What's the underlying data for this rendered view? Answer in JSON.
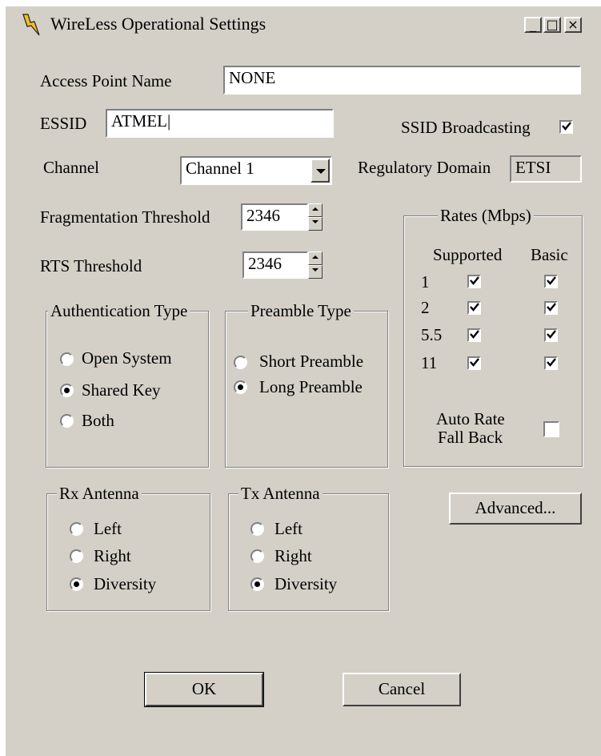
{
  "window": {
    "title": "WireLess Operational Settings"
  },
  "titlebar_buttons": {
    "minimize": "_",
    "maximize": "□",
    "close": "×"
  },
  "fields": {
    "access_point_name": {
      "label": "Access Point Name",
      "value": "NONE"
    },
    "essid": {
      "label": "ESSID",
      "value": "ATMEL"
    },
    "ssid_broadcasting": {
      "label": "SSID Broadcasting",
      "checked": true
    },
    "channel": {
      "label": "Channel",
      "value": "Channel 1"
    },
    "regulatory_domain": {
      "label": "Regulatory Domain",
      "value": "ETSI"
    },
    "fragmentation_threshold": {
      "label": "Fragmentation Threshold",
      "value": "2346"
    },
    "rts_threshold": {
      "label": "RTS Threshold",
      "value": "2346"
    }
  },
  "rates": {
    "title": "Rates (Mbps)",
    "col_supported": "Supported",
    "col_basic": "Basic",
    "rows": [
      {
        "rate": "1",
        "supported": true,
        "basic": true
      },
      {
        "rate": "2",
        "supported": true,
        "basic": true
      },
      {
        "rate": "5.5",
        "supported": true,
        "basic": true
      },
      {
        "rate": "11",
        "supported": true,
        "basic": true
      }
    ],
    "auto_rate_line1": "Auto Rate",
    "auto_rate_line2": "Fall Back",
    "auto_rate_checked": false
  },
  "authentication": {
    "title": "Authentication Type",
    "options": [
      "Open System",
      "Shared Key",
      "Both"
    ],
    "selected": 1
  },
  "preamble": {
    "title": "Preamble Type",
    "options": [
      "Short Preamble",
      "Long Preamble"
    ],
    "selected": 1
  },
  "rx_antenna": {
    "title": "Rx Antenna",
    "options": [
      "Left",
      "Right",
      "Diversity"
    ],
    "selected": 2
  },
  "tx_antenna": {
    "title": "Tx Antenna",
    "options": [
      "Left",
      "Right",
      "Diversity"
    ],
    "selected": 2
  },
  "buttons": {
    "advanced": "Advanced...",
    "ok": "OK",
    "cancel": "Cancel"
  }
}
